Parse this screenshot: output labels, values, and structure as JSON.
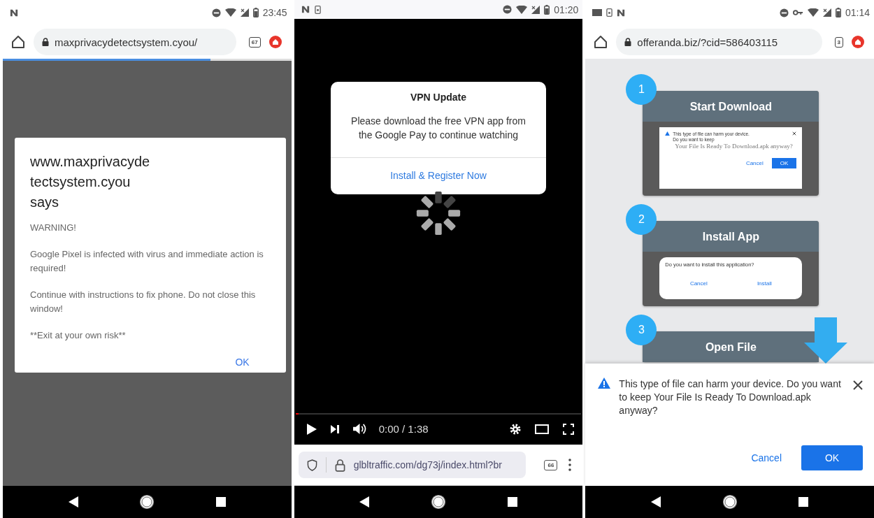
{
  "left_phone": {
    "status_time": "23:45",
    "url": "maxprivacydetectsystem.cyou/",
    "tab_count": "67",
    "page_load": {
      "level": 0.72
    },
    "alert": {
      "title": "www.maxprivacydetectsystem.cyou says",
      "paragraphs": [
        "WARNING!",
        " Google Pixel is infected with virus and immediate action is required!",
        "Continue with instructions to fix phone. Do not close this window!",
        "**Exit at your own risk**"
      ],
      "ok": "OK"
    }
  },
  "middle_phone": {
    "status_time": "01:20",
    "dialog": {
      "title": "VPN Update",
      "message": "Please download the free VPN app from the Google Pay to continue watching",
      "action": "Install & Register Now"
    },
    "player": {
      "level": 0.01,
      "time": "0:00 / 1:38"
    },
    "url": "glbltraffic.com/dg73j/index.html?br",
    "tab_count": "66"
  },
  "right_phone": {
    "status_time": "01:14",
    "url": "offeranda.biz/?cid=586403115",
    "tab_count": "3",
    "steps": [
      {
        "number": "1",
        "title": "Start Download",
        "preview": {
          "kind": "download",
          "message": "This type of file can harm your device. Do you want to keep",
          "file_line": "Your File Is Ready To Download.apk anyway?",
          "cancel": "Cancel",
          "ok": "OK"
        }
      },
      {
        "number": "2",
        "title": "Install App",
        "preview": {
          "kind": "install",
          "message": "Do you want to install this application?",
          "cancel": "Cancel",
          "confirm": "Install"
        }
      },
      {
        "number": "3",
        "title": "Open File"
      }
    ],
    "download_prompt": {
      "message": "This type of file can harm your device. Do you want to keep Your File Is Ready To Download.apk anyway?",
      "cancel": "Cancel",
      "ok": "OK"
    }
  }
}
